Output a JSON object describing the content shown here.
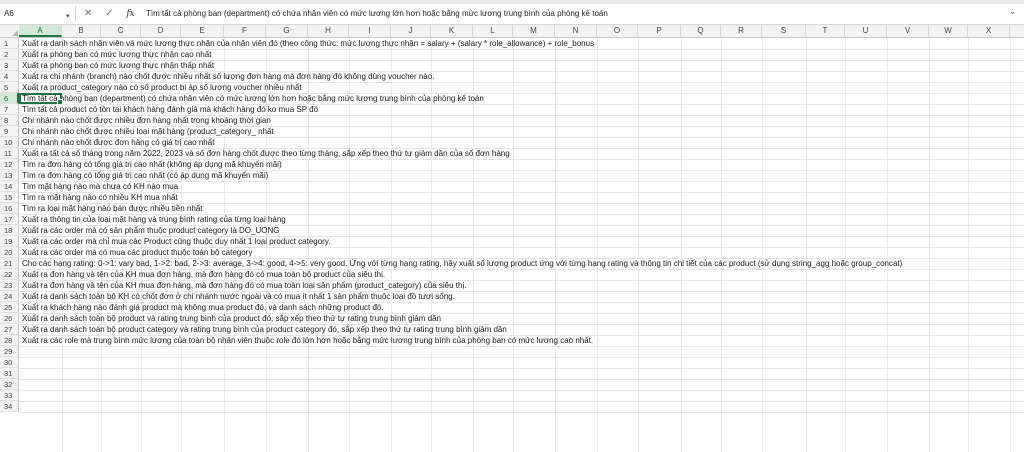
{
  "formula_bar": {
    "name_box": "A6",
    "cancel_glyph": "✕",
    "enter_glyph": "✓",
    "fx_label": "fx",
    "formula": "Tìm tất cả phòng ban (department) có chứa nhân viên có mức lương lớn hơn hoặc bằng mức lương trung bình của phòng kế toán"
  },
  "selection": {
    "column": "A",
    "row": 6
  },
  "columns": [
    "A",
    "B",
    "C",
    "D",
    "E",
    "F",
    "G",
    "H",
    "I",
    "J",
    "K",
    "L",
    "M",
    "N",
    "O",
    "P",
    "Q",
    "R",
    "S",
    "T",
    "U",
    "V",
    "W",
    "X"
  ],
  "rows": [
    {
      "num": "1",
      "text": "Xuất ra danh sách nhân viên và mức lương thực nhận của nhân viên đó (theo công thức: mức lương thực nhận = salary + (salary * role_allowance) + role_bonus"
    },
    {
      "num": "2",
      "text": "Xuất ra phòng ban có mức lương thực nhận cao nhất"
    },
    {
      "num": "3",
      "text": "Xuất ra phòng ban có mức lương thực nhận thấp nhất"
    },
    {
      "num": "4",
      "text": "Xuất ra chi nhánh (branch) nào chốt được nhiều nhất số lượng đơn hàng mà đơn hàng đó không dùng voucher nào."
    },
    {
      "num": "5",
      "text": "Xuất ra product_category nào có số product bị áp số lượng voucher nhiều nhất"
    },
    {
      "num": "6",
      "text": "Tìm tất cả phòng ban (department) có chứa nhân viên có mức lương lớn hơn hoặc bằng mức lương trung bình của phòng kế toán"
    },
    {
      "num": "7",
      "text": "Tìm tất cả product có tồn tại khách hàng đánh giá mà khách hàng đó ko mua SP đó"
    },
    {
      "num": "8",
      "text": "Chi nhánh nào chốt được nhiều đơn hàng nhất trong khoảng thời gian"
    },
    {
      "num": "9",
      "text": "Chi nhánh nào chốt được nhiều loại mặt hàng (product_category_ nhất"
    },
    {
      "num": "10",
      "text": "Chi nhánh nào chốt được đơn hàng có giá trị cao nhất"
    },
    {
      "num": "11",
      "text": "Xuất ra tất cả số tháng trong năm 2022, 2023 và số đơn hàng chốt được theo từng tháng, sắp xếp theo thứ tự giảm dần của số đơn hàng"
    },
    {
      "num": "12",
      "text": "Tìm ra đơn hàng có tổng giá trị cao nhất (không áp dụng mã khuyến mãi)"
    },
    {
      "num": "13",
      "text": "Tìm ra đơn hàng có tổng giá trị cao nhất (có áp dụng mã khuyến mãi)"
    },
    {
      "num": "14",
      "text": "Tìm mặt hàng nào mà chưa có KH nào mua"
    },
    {
      "num": "15",
      "text": "Tìm ra mặt hàng nào có nhiều KH mua nhất"
    },
    {
      "num": "16",
      "text": "Tìm ra loại mặt hàng nào bán được nhiều tiền nhất"
    },
    {
      "num": "17",
      "text": "Xuất ra thông tin của loại mặt hàng và trung bình rating của từng loại hàng"
    },
    {
      "num": "18",
      "text": "Xuất ra các order mà có sản phẩm thuộc product category là DO_UONG"
    },
    {
      "num": "19",
      "text": "Xuất ra các order mà chỉ mua các Product cùng thuộc duy nhất 1 loại product category."
    },
    {
      "num": "20",
      "text": "Xuất ra các order mà có mua các product thuộc toàn bộ category"
    },
    {
      "num": "21",
      "text": "Cho các hạng rating: 0->1: vary bad, 1->2: bad, 2->3: average, 3->4: good, 4->5: very good. Ứng với từng hạng rating, hãy xuất số lượng product ứng với từng hạng rating và thông tin chi tiết của các product (sử dụng string_agg hoặc group_concat)"
    },
    {
      "num": "22",
      "text": "Xuất ra đơn hàng và tên của KH mua đơn hàng, mà đơn hàng đó có mua toàn bộ product của siêu thị."
    },
    {
      "num": "23",
      "text": "Xuất ra đơn hàng và tên của KH mua đơn hàng, mà đơn hàng đó có mua toàn loại sản phẩm (product_category) của siêu thị."
    },
    {
      "num": "24",
      "text": "Xuất ra danh sách toàn bộ KH có chốt đơn ở chi nhánh nước ngoài và có mua ít nhất 1 sản phẩm thuộc loại đồ tươi sống."
    },
    {
      "num": "25",
      "text": "Xuất ra khách hàng nào đánh giá product mà không mua product đó, và danh sách những product đó."
    },
    {
      "num": "26",
      "text": "Xuất ra danh sách toàn bộ product và rating trung bình của product đó, sắp xếp theo thứ tự rating trung bình giảm dần"
    },
    {
      "num": "27",
      "text": "Xuất ra danh sách toàn bộ product category và rating trung bình của product category đó, sắp xếp theo thứ tự rating trung bình giảm dần"
    },
    {
      "num": "28",
      "text": "Xuất ra các role mà trung bình mức lương của toàn bộ nhân viên thuộc role đó lớn hơn hoặc bằng mức lương trung bình của phòng ban có mức lương cao nhất."
    },
    {
      "num": "29",
      "text": ""
    },
    {
      "num": "30",
      "text": ""
    },
    {
      "num": "31",
      "text": ""
    },
    {
      "num": "32",
      "text": ""
    },
    {
      "num": "33",
      "text": ""
    },
    {
      "num": "34",
      "text": ""
    }
  ]
}
